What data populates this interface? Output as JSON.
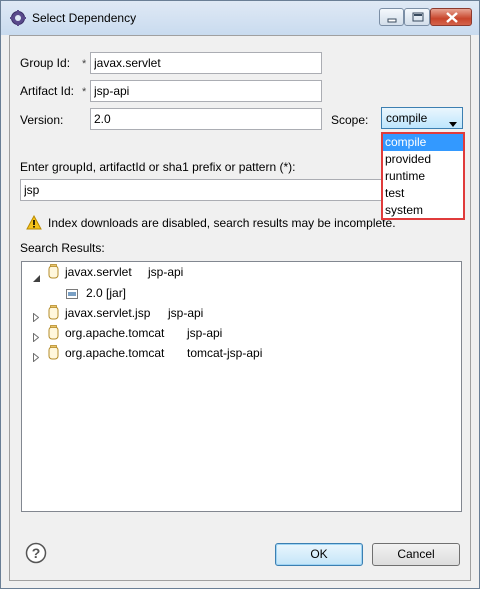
{
  "window": {
    "title": "Select Dependency"
  },
  "form": {
    "group_id_label": "Group Id:",
    "group_id_value": "javax.servlet",
    "artifact_id_label": "Artifact Id:",
    "artifact_id_value": "jsp-api",
    "version_label": "Version:",
    "version_value": "2.0",
    "required_marker": "*",
    "scope_label": "Scope:",
    "scope_value": "compile"
  },
  "scope_options": [
    "compile",
    "provided",
    "runtime",
    "test",
    "system"
  ],
  "search": {
    "label": "Enter groupId, artifactId or sha1 prefix or pattern (*):",
    "value": "jsp",
    "warning": "Index downloads are disabled, search results may be incomplete."
  },
  "results": {
    "label": "Search Results:",
    "items": [
      {
        "group": "javax.servlet",
        "artifact": "jsp-api",
        "expanded": true,
        "children": [
          "2.0 [jar]"
        ]
      },
      {
        "group": "javax.servlet.jsp",
        "artifact": "jsp-api",
        "expanded": false
      },
      {
        "group": "org.apache.tomcat",
        "artifact": "jsp-api",
        "expanded": false
      },
      {
        "group": "org.apache.tomcat",
        "artifact": "tomcat-jsp-api",
        "expanded": false
      }
    ]
  },
  "buttons": {
    "ok": "OK",
    "cancel": "Cancel"
  },
  "icons": {
    "app": "eclipse-gear-icon",
    "warning": "warning-icon",
    "help": "help-icon",
    "jar": "jar-icon",
    "artifact": "maven-artifact-icon"
  },
  "colors": {
    "selection": "#3399ff",
    "highlight_border": "#e03b3b",
    "window_border": "#6a7f96"
  }
}
